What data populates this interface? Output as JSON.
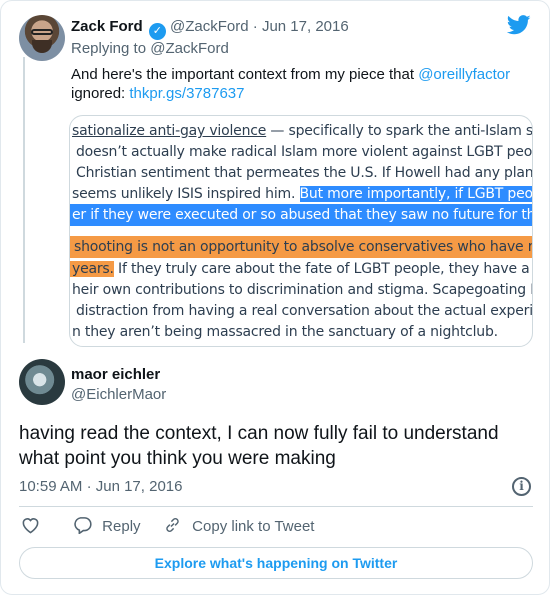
{
  "parent_tweet": {
    "name": "Zack Ford",
    "handle": "@ZackFord",
    "date": "Jun 17, 2016",
    "separator": "·",
    "replying_prefix": "Replying to",
    "replying_to": "@ZackFord",
    "text_before_mention": "And here's the important context from my piece that ",
    "mention": "@oreillyfactor",
    "text_after_mention": " ignored: ",
    "link": "thkpr.gs/3787637"
  },
  "article_screenshot": {
    "line1_underlined": "sationalize anti-gay violence",
    "line1_rest": " — specifically to spark the anti-Islam sentimen",
    "line2": "doesn’t actually make radical Islam more violent against LGBT people than",
    "line3": "Christian sentiment that permeates the U.S. If Howell had any plans for vi",
    "line4_plain": "seems unlikely ISIS inspired him. ",
    "line4_highlight": "But more importantly, if LGBT people end",
    "line5_highlight": "er if they were executed or so abused that they saw no future for themsel",
    "line6_highlight": "shooting is not an opportunity to absolve conservatives who have railed a",
    "line7_highlight": "years.",
    "line7_rest": " If they truly care about the fate of LGBT people, they have a respons",
    "line8": "heir own contributions to discrimination and stigma. Scapegoating Islam is",
    "line9": "distraction from having a real conversation about the actual experience of",
    "line10": "n they aren’t being massacred in the sanctuary of a nightclub."
  },
  "reply_tweet": {
    "name": "maor eichler",
    "handle": "@EichlerMaor",
    "text": "having read the context, I can now fully fail to understand what point you think you were making",
    "time": "10:59 AM",
    "separator": "·",
    "date": "Jun 17, 2016"
  },
  "actions": {
    "reply_label": "Reply",
    "copy_link_label": "Copy link to Tweet"
  },
  "explore_label": "Explore what's happening on Twitter",
  "colors": {
    "accent": "#1d9bf0",
    "text": "#0f1419",
    "muted": "#536471",
    "highlight_blue": "#2e8cff",
    "highlight_orange": "#f59a45"
  },
  "icons": [
    "verified-badge-icon",
    "twitter-bird-icon",
    "info-icon",
    "heart-icon",
    "reply-icon",
    "link-icon"
  ]
}
